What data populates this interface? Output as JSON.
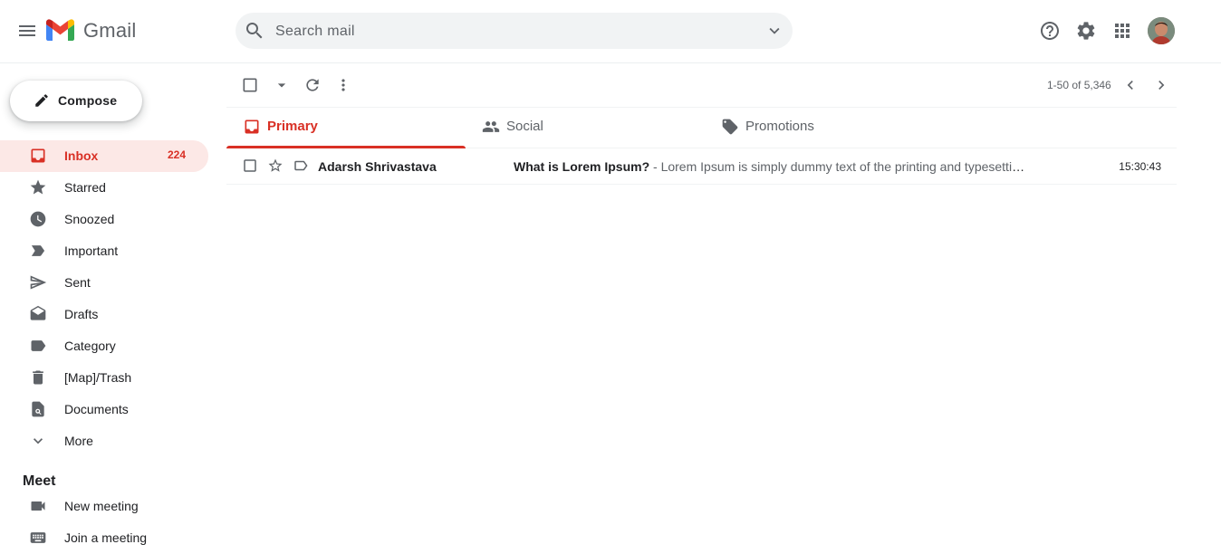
{
  "header": {
    "brand": "Gmail",
    "search_placeholder": "Search mail",
    "icons": [
      "menu-icon",
      "gmail-logo",
      "search-icon",
      "chevron-down-icon",
      "help-icon",
      "gear-icon",
      "apps-grid-icon",
      "avatar"
    ]
  },
  "sidebar": {
    "compose_label": "Compose",
    "items": [
      {
        "label": "Inbox",
        "count": "224",
        "icon": "inbox-icon",
        "active": true
      },
      {
        "label": "Starred",
        "icon": "star-icon"
      },
      {
        "label": "Snoozed",
        "icon": "clock-icon"
      },
      {
        "label": "Important",
        "icon": "important-icon"
      },
      {
        "label": "Sent",
        "icon": "send-icon"
      },
      {
        "label": "Drafts",
        "icon": "draft-icon"
      },
      {
        "label": "Category",
        "icon": "label-icon"
      },
      {
        "label": "[Map]/Trash",
        "icon": "trash-icon"
      },
      {
        "label": "Documents",
        "icon": "document-search-icon"
      },
      {
        "label": "More",
        "icon": "chevron-down-icon"
      }
    ],
    "meet": {
      "title": "Meet",
      "items": [
        {
          "label": "New meeting",
          "icon": "video-icon"
        },
        {
          "label": "Join a meeting",
          "icon": "keyboard-icon"
        }
      ]
    }
  },
  "toolbar": {
    "pager": "1-50 of 5,346"
  },
  "tabs": [
    {
      "label": "Primary",
      "icon": "inbox-icon",
      "active": true
    },
    {
      "label": "Social",
      "icon": "people-icon"
    },
    {
      "label": "Promotions",
      "icon": "tag-icon"
    }
  ],
  "emails": [
    {
      "sender": "Adarsh Shrivastava",
      "subject": "What is Lorem Ipsum?",
      "snippet": " - Lorem Ipsum is simply dummy text of the printing and typesetting industry.",
      "time": "15:30:43"
    }
  ],
  "colors": {
    "accent": "#d93025",
    "active_bg": "#fce8e6",
    "icon_gray": "#5f6368",
    "search_bg": "#f1f3f4"
  }
}
